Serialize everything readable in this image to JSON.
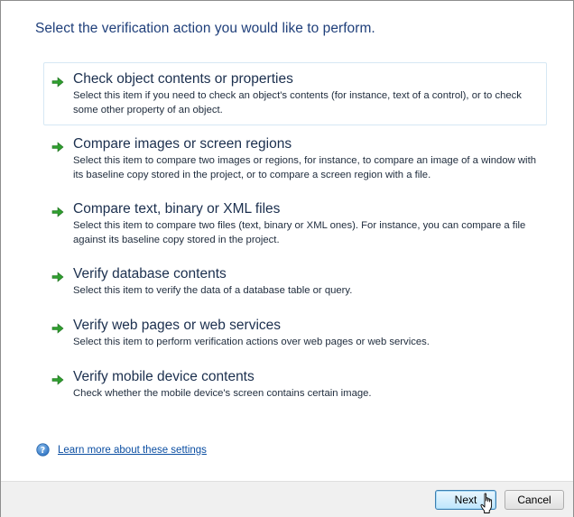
{
  "heading": "Select the verification action you would like to perform.",
  "options": [
    {
      "title": "Check object contents or properties",
      "description": "Select this item if you need to check an object's contents (for instance, text of a control), or to check some other property of an object.",
      "icon": "green-arrow-icon",
      "selected": true
    },
    {
      "title": "Compare images or screen regions",
      "description": "Select this item to compare two images or regions, for instance, to compare an image of a window with its baseline copy stored in the project, or to compare a screen region with a file.",
      "icon": "green-arrow-icon",
      "selected": false
    },
    {
      "title": "Compare text, binary or XML files",
      "description": "Select this item to compare two files (text, binary or XML ones). For instance, you can compare a file against its baseline copy stored in the project.",
      "icon": "green-arrow-icon",
      "selected": false
    },
    {
      "title": "Verify database contents",
      "description": "Select this item to verify the data of a database table or query.",
      "icon": "green-arrow-icon",
      "selected": false
    },
    {
      "title": "Verify web pages or web services",
      "description": "Select this item to perform verification actions over web pages or web services.",
      "icon": "green-arrow-icon",
      "selected": false
    },
    {
      "title": "Verify mobile device contents",
      "description": "Check whether the mobile device's screen contains certain image.",
      "icon": "green-arrow-icon",
      "selected": false
    }
  ],
  "help": {
    "link_text": "Learn more about these settings",
    "icon": "help-question-icon"
  },
  "footer": {
    "next_label": "Next",
    "cancel_label": "Cancel"
  },
  "colors": {
    "accent_arrow": "#2f9e2f",
    "link": "#0b4ea2",
    "selection_border": "#d6e8f4"
  }
}
